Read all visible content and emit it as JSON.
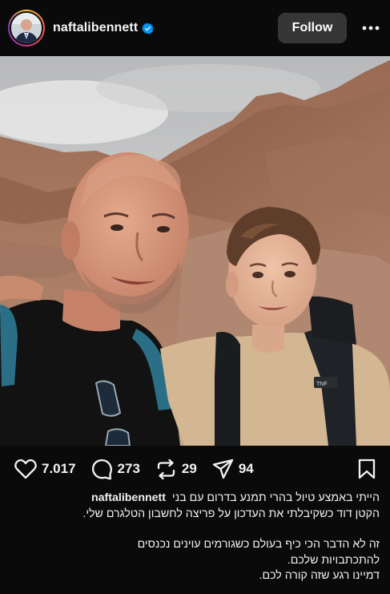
{
  "header": {
    "username": "naftalibennett",
    "verified": true,
    "follow_label": "Follow",
    "icons": {
      "avatar": "profile-avatar",
      "verified": "verified-badge-icon",
      "more": "more-options-icon"
    }
  },
  "post": {
    "media": "photo-selfie-two-hikers-desert-mountains"
  },
  "actions": {
    "likes": "7.017",
    "comments": "273",
    "reposts": "29",
    "shares": "94",
    "icons": [
      "heart-icon",
      "comment-icon",
      "repost-icon",
      "share-icon",
      "save-icon"
    ]
  },
  "caption": {
    "username": "naftalibennett",
    "line1": "הייתי באמצע טיול בהרי תמנע בדרום עם בני",
    "line2": "הקטן דוד כשקיבלתי את העדכון על פריצה לחשבון הטלגרם שלי.",
    "line3": "זה לא הדבר הכי כיף בעולם כשגורמים עוינים נכנסים",
    "line4": "להתכתבויות שלכם.",
    "line5": "דמיינו רגע שזה קורה לכם."
  },
  "colors": {
    "background": "#0a0a0a",
    "follow_button": "#363636",
    "verified_blue": "#0095f6",
    "text": "#f5f5f5"
  }
}
